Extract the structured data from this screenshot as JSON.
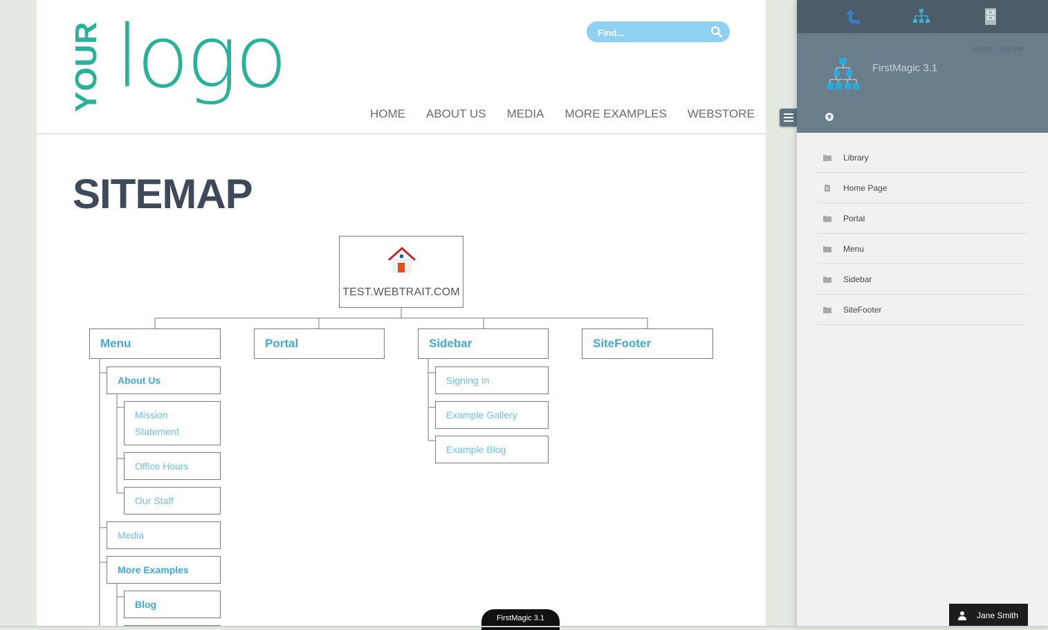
{
  "site": {
    "logo": {
      "your": "YOUR",
      "logo": "logo"
    },
    "search": {
      "placeholder": "Find..."
    },
    "nav": [
      "HOME",
      "ABOUT US",
      "MEDIA",
      "MORE EXAMPLES",
      "WEBSTORE"
    ],
    "page_title": "SITEMAP"
  },
  "sitemap": {
    "root": "TEST.WEBTRAIT.COM",
    "menu": {
      "label": "Menu",
      "about_us": "About Us",
      "mission_statement": "Mission Statement",
      "office_hours": "Office Hours",
      "our_staff": "Our Staff",
      "media": "Media",
      "more_examples": "More Examples",
      "blog": "Blog"
    },
    "portal": "Portal",
    "sidebar": {
      "label": "Sidebar",
      "signing_in": "Signing In",
      "example_gallery": "Example Gallery",
      "example_blog": "Example Blog"
    },
    "sitefooter": "SiteFooter"
  },
  "panel": {
    "date": "04/10/17, 6:01 PM",
    "app_title": "FirstMagic 3.1",
    "items": [
      "Library",
      "Home Page",
      "Portal",
      "Menu",
      "Sidebar",
      "SiteFooter"
    ]
  },
  "user": {
    "name": "Jane Smith"
  },
  "bottom_tab": "FirstMagic 3.1",
  "colors": {
    "brand_teal": "#2ab19a",
    "link_blue": "#3fa9de",
    "title_slate": "#3e4a5a",
    "panel_dark": "#4c5d69",
    "panel_header": "#687e8a"
  }
}
